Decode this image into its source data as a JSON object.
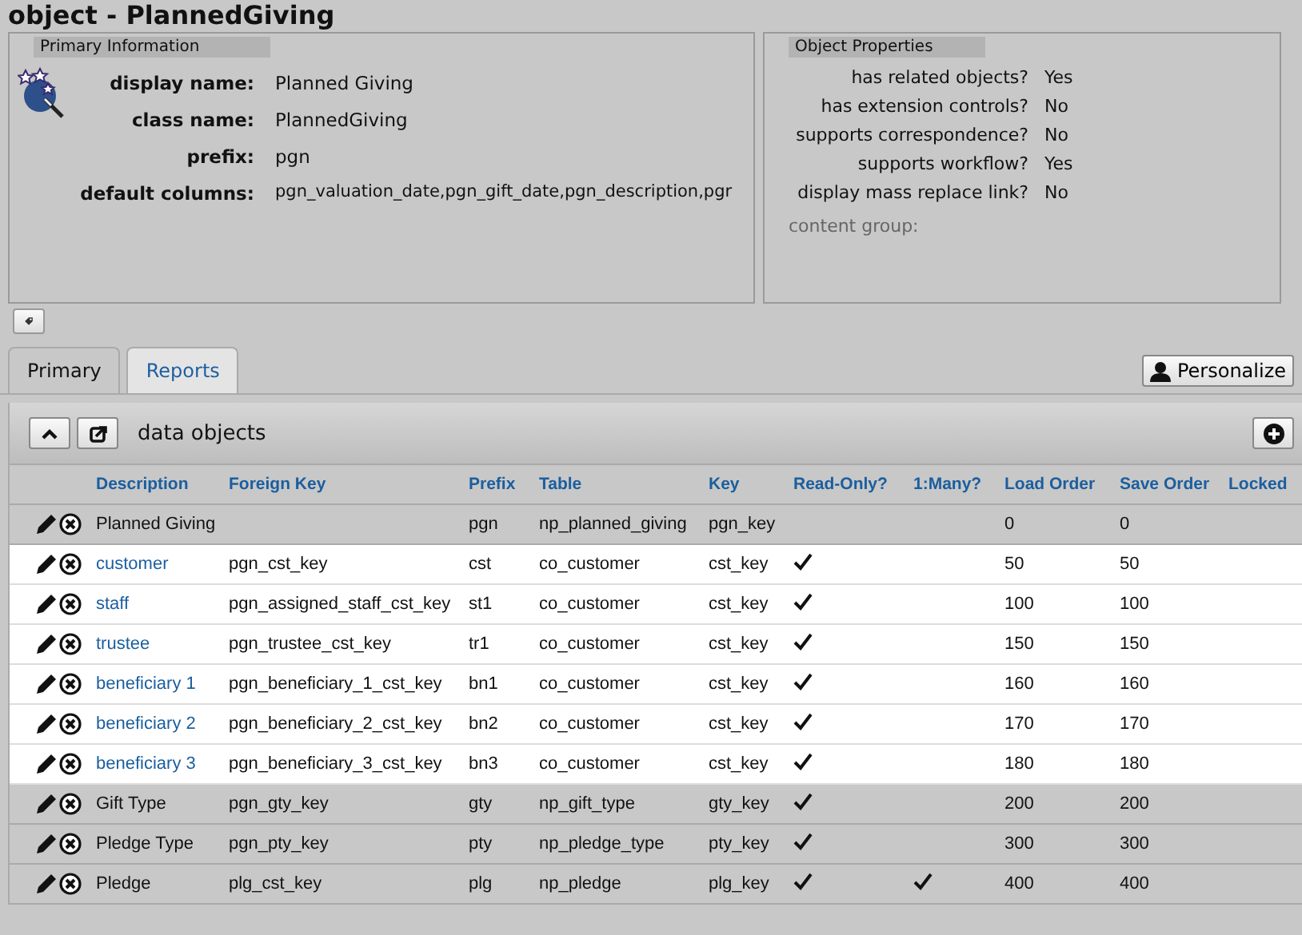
{
  "title": "object - PlannedGiving",
  "primary_info": {
    "heading": "Primary Information",
    "fields": [
      {
        "label": "display name:",
        "value": "Planned Giving"
      },
      {
        "label": "class name:",
        "value": "PlannedGiving"
      },
      {
        "label": "prefix:",
        "value": "pgn"
      },
      {
        "label": "default columns:",
        "value": "pgn_valuation_date,pgn_gift_date,pgn_description,pgr"
      }
    ]
  },
  "object_properties": {
    "heading": "Object Properties",
    "fields": [
      {
        "label": "has related objects?",
        "value": "Yes"
      },
      {
        "label": "has extension controls?",
        "value": "No"
      },
      {
        "label": "supports correspondence?",
        "value": "No"
      },
      {
        "label": "supports workflow?",
        "value": "Yes"
      },
      {
        "label": "display mass replace link?",
        "value": "No"
      }
    ],
    "content_group_label": "content group:"
  },
  "tabs": [
    {
      "label": "Primary",
      "selected": true
    },
    {
      "label": "Reports",
      "selected": false
    }
  ],
  "personalize_button": "Personalize",
  "section_title": "data objects",
  "table": {
    "columns": [
      "Description",
      "Foreign Key",
      "Prefix",
      "Table",
      "Key",
      "Read-Only?",
      "1:Many?",
      "Load Order",
      "Save Order",
      "Locked"
    ],
    "rows": [
      {
        "description": "Planned Giving",
        "foreign_key": "",
        "prefix": "pgn",
        "table": "np_planned_giving",
        "key": "pgn_key",
        "read_only": false,
        "one_to_many": false,
        "load_order": "0",
        "save_order": "0",
        "highlighted": false
      },
      {
        "description": "customer",
        "foreign_key": "pgn_cst_key",
        "prefix": "cst",
        "table": "co_customer",
        "key": "cst_key",
        "read_only": true,
        "one_to_many": false,
        "load_order": "50",
        "save_order": "50",
        "highlighted": true
      },
      {
        "description": "staff",
        "foreign_key": "pgn_assigned_staff_cst_key",
        "prefix": "st1",
        "table": "co_customer",
        "key": "cst_key",
        "read_only": true,
        "one_to_many": false,
        "load_order": "100",
        "save_order": "100",
        "highlighted": true
      },
      {
        "description": "trustee",
        "foreign_key": "pgn_trustee_cst_key",
        "prefix": "tr1",
        "table": "co_customer",
        "key": "cst_key",
        "read_only": true,
        "one_to_many": false,
        "load_order": "150",
        "save_order": "150",
        "highlighted": true
      },
      {
        "description": "beneficiary 1",
        "foreign_key": "pgn_beneficiary_1_cst_key",
        "prefix": "bn1",
        "table": "co_customer",
        "key": "cst_key",
        "read_only": true,
        "one_to_many": false,
        "load_order": "160",
        "save_order": "160",
        "highlighted": true
      },
      {
        "description": "beneficiary 2",
        "foreign_key": "pgn_beneficiary_2_cst_key",
        "prefix": "bn2",
        "table": "co_customer",
        "key": "cst_key",
        "read_only": true,
        "one_to_many": false,
        "load_order": "170",
        "save_order": "170",
        "highlighted": true
      },
      {
        "description": "beneficiary 3",
        "foreign_key": "pgn_beneficiary_3_cst_key",
        "prefix": "bn3",
        "table": "co_customer",
        "key": "cst_key",
        "read_only": true,
        "one_to_many": false,
        "load_order": "180",
        "save_order": "180",
        "highlighted": true
      },
      {
        "description": "Gift Type",
        "foreign_key": "pgn_gty_key",
        "prefix": "gty",
        "table": "np_gift_type",
        "key": "gty_key",
        "read_only": true,
        "one_to_many": false,
        "load_order": "200",
        "save_order": "200",
        "highlighted": false
      },
      {
        "description": "Pledge Type",
        "foreign_key": "pgn_pty_key",
        "prefix": "pty",
        "table": "np_pledge_type",
        "key": "pty_key",
        "read_only": true,
        "one_to_many": false,
        "load_order": "300",
        "save_order": "300",
        "highlighted": false
      },
      {
        "description": "Pledge",
        "foreign_key": "plg_cst_key",
        "prefix": "plg",
        "table": "np_pledge",
        "key": "plg_key",
        "read_only": true,
        "one_to_many": true,
        "load_order": "400",
        "save_order": "400",
        "highlighted": false
      }
    ]
  }
}
